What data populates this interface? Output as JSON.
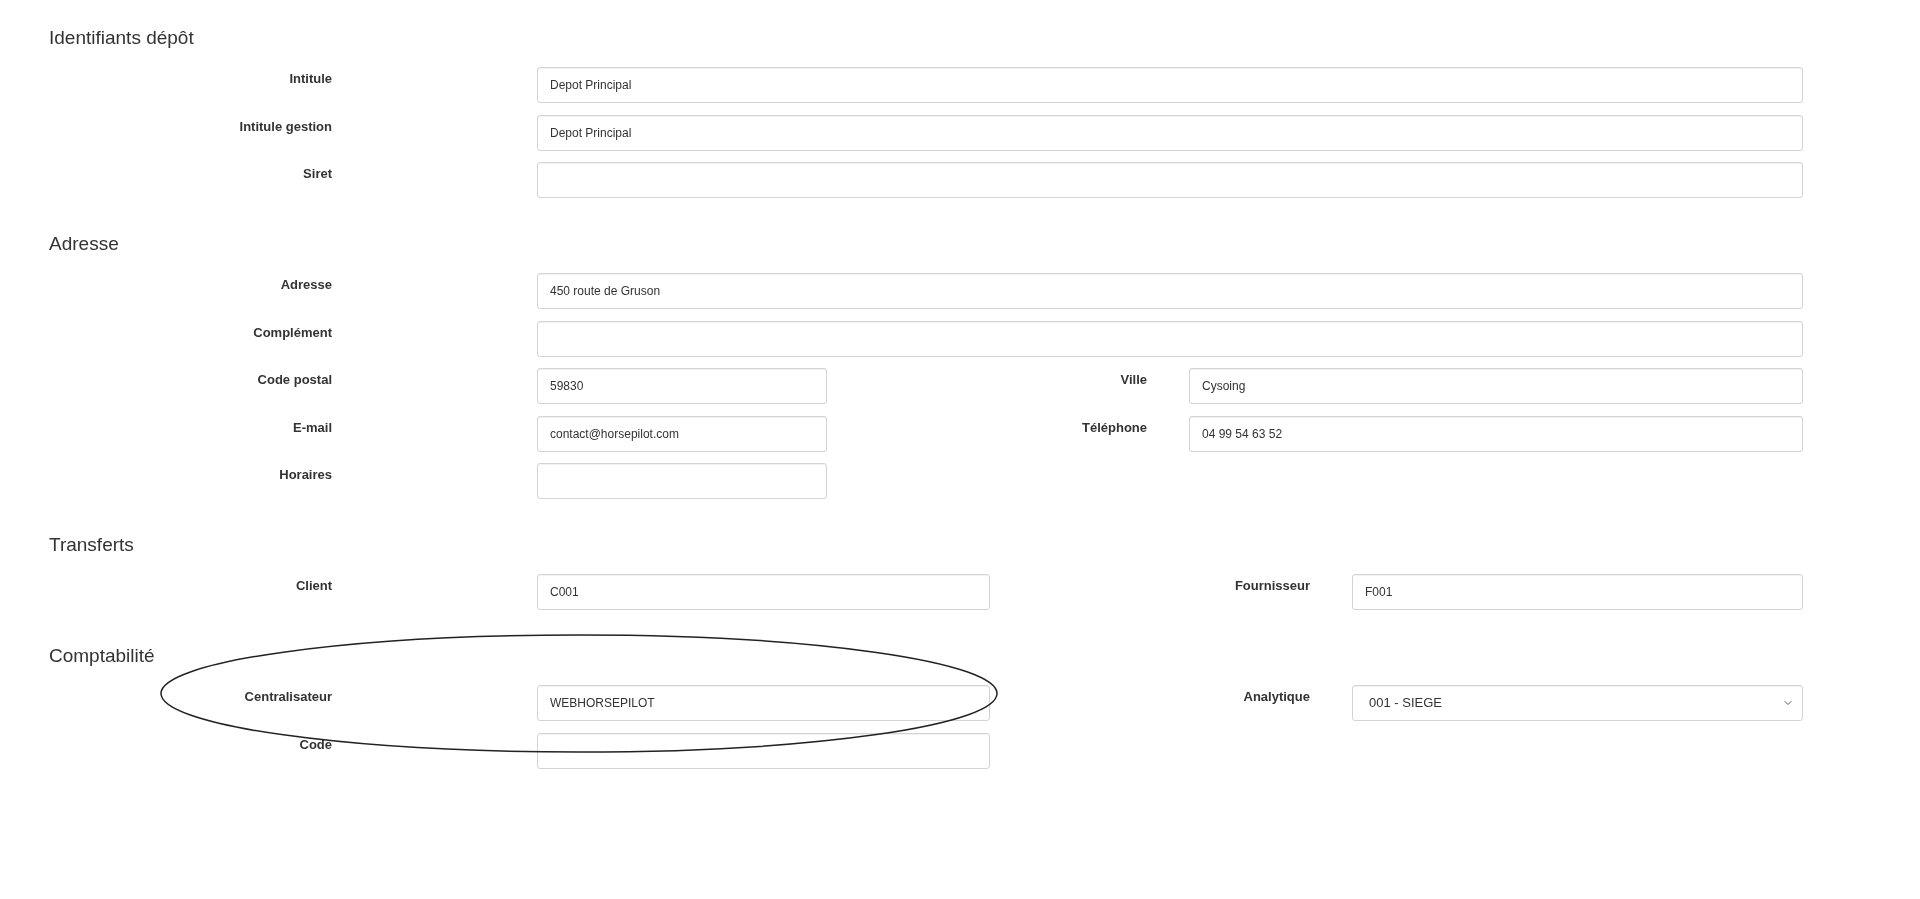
{
  "sections": [
    {
      "title": "Identifiants dépôt",
      "rows": [
        {
          "kind": "full",
          "fields": [
            {
              "label": "Intitule",
              "value": "Depot Principal",
              "kind": "text"
            }
          ]
        },
        {
          "kind": "full",
          "fields": [
            {
              "label": "Intitule gestion",
              "value": "Depot Principal",
              "kind": "text"
            }
          ]
        },
        {
          "kind": "full",
          "fields": [
            {
              "label": "Siret",
              "kind": "text"
            }
          ]
        }
      ]
    },
    {
      "title": "Adresse",
      "rows": [
        {
          "kind": "full",
          "fields": [
            {
              "label": "Adresse",
              "value": "450 route de Gruson",
              "kind": "text"
            }
          ]
        },
        {
          "kind": "full",
          "fields": [
            {
              "label": "Complément",
              "kind": "text"
            }
          ]
        },
        {
          "kind": "short",
          "fields": [
            {
              "label": "Code postal",
              "value": "59830",
              "kind": "text"
            }
          ],
          "side_field": {
            "label": "Ville",
            "value": "Cysoing",
            "kind": "text"
          }
        },
        {
          "kind": "short",
          "fields": [
            {
              "label": "E-mail",
              "value": "contact@horsepilot.com",
              "kind": "text"
            },
            {
              "label": "Téléphone",
              "value": "04 99 54 63 52",
              "kind": "text"
            }
          ]
        },
        {
          "kind": "short",
          "fields": [
            {
              "label": "Horaires",
              "kind": "text"
            }
          ]
        }
      ]
    },
    {
      "title": "Transferts",
      "rows": [
        {
          "kind": "medium",
          "fields": [
            {
              "label": "Client",
              "value": "C001",
              "kind": "text"
            },
            {
              "label": "Fournisseur",
              "value": "F001",
              "kind": "text"
            }
          ]
        }
      ]
    },
    {
      "title": "Comptabilité",
      "rows": [
        {
          "kind": "medium",
          "fields": [
            {
              "label": "Centralisateur",
              "value": "WEBHORSEPILOT",
              "kind": "text"
            },
            {
              "label": "Analytique",
              "value": "001 - SIEGE",
              "kind": "select"
            }
          ]
        },
        {
          "kind": "medium",
          "fields": [
            {
              "label": "Code",
              "kind": "text"
            }
          ]
        }
      ]
    }
  ]
}
